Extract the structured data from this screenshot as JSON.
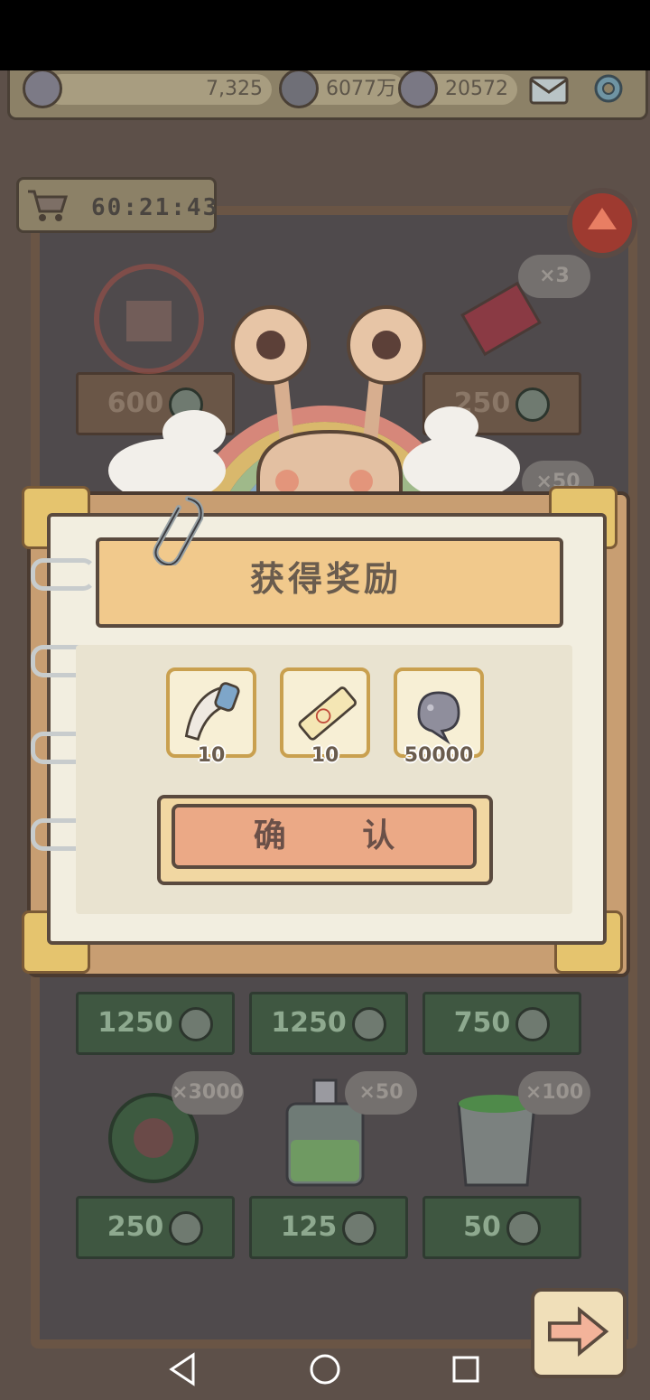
{
  "status_bar": {},
  "resources": {
    "coins": "7,325",
    "tadpoles": "6077万",
    "bubbles": "20572"
  },
  "shop": {
    "timer": "60:21:43",
    "top_row": [
      {
        "price": "600"
      },
      {
        "price": "250"
      }
    ],
    "hidden_row_badges": [
      "×3",
      "×50"
    ],
    "middle_row": [
      {
        "price": "1250"
      },
      {
        "price": "1250"
      },
      {
        "price": "750"
      }
    ],
    "bottom_row": [
      {
        "badge": "×3000",
        "price": "250"
      },
      {
        "badge": "×50",
        "price": "125"
      },
      {
        "badge": "×100",
        "price": "50"
      }
    ]
  },
  "dialog": {
    "title": "获得奖励",
    "rewards": [
      {
        "icon": "horn-item-icon",
        "count": "10"
      },
      {
        "icon": "paint-tube-icon",
        "count": "10"
      },
      {
        "icon": "speech-bubble-currency-icon",
        "count": "50000"
      }
    ],
    "confirm_label": "确 认"
  },
  "colors": {
    "dialog_title_bg": "#f1c98c",
    "confirm_bg": "#eba986",
    "shelf_green": "#3f5741"
  }
}
